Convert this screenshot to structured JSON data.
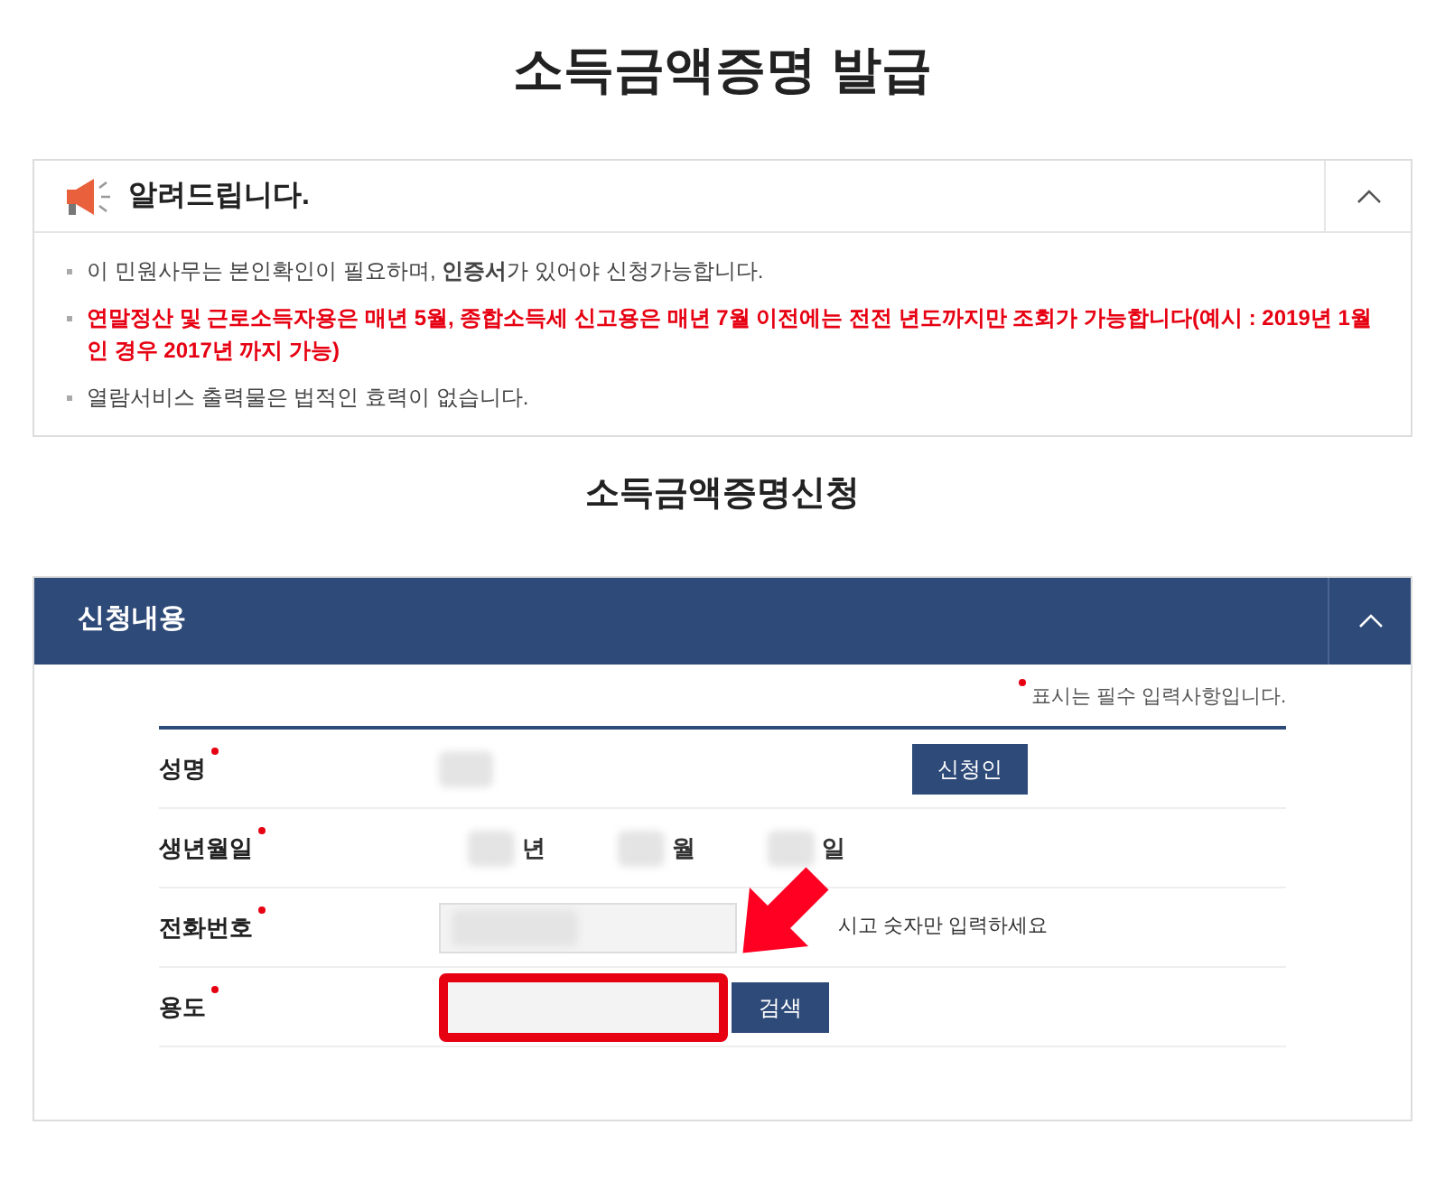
{
  "page_title": "소득금액증명 발급",
  "notice": {
    "title": "알려드립니다.",
    "expanded": true,
    "items": [
      {
        "text": "이 민원사무는 본인확인이 필요하며, **인증서**가 있어야 신청가능합니다.",
        "kind": "normal"
      },
      {
        "text": "**연말정산 및 근로소득자용은 매년 5월, 종합소득세 신고용은 매년 7월 이전에는 전전 년도까지만 조회가 가능합니다(예시 : 2019년 1월 인 경우 2017년 까지 가능)**",
        "kind": "warning"
      },
      {
        "text": "열람서비스 출력물은 법적인 효력이 없습니다.",
        "kind": "normal"
      }
    ]
  },
  "section_title": "소득금액증명신청",
  "panel": {
    "title": "신청내용",
    "expanded": true,
    "required_note": "표시는 필수 입력사항입니다.",
    "rows": [
      {
        "label": "성명",
        "kind": "name",
        "button": "신청인"
      },
      {
        "label": "생년월일",
        "kind": "date",
        "units": [
          "년",
          "월",
          "일"
        ]
      },
      {
        "label": "전화번호",
        "kind": "phone",
        "hint": "시고 숫자만 입력하세요"
      },
      {
        "label": "용도",
        "kind": "search",
        "button": "검색"
      }
    ]
  }
}
